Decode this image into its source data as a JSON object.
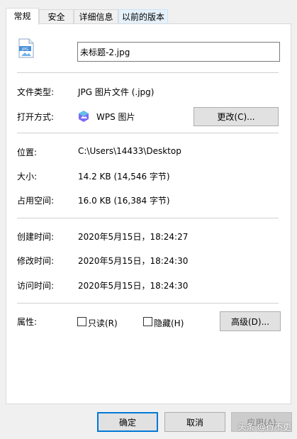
{
  "tabs": [
    {
      "label": "常规",
      "active": true
    },
    {
      "label": "安全"
    },
    {
      "label": "详细信息"
    },
    {
      "label": "以前的版本"
    }
  ],
  "file": {
    "icon": "jpg-file-icon",
    "icon_text": "JPG",
    "name": "未标题-2.jpg"
  },
  "props": {
    "type_label": "文件类型:",
    "type_value": "JPG 图片文件 (.jpg)",
    "open_label": "打开方式:",
    "open_app": "WPS 图片",
    "open_app_icon": "wps-image-icon",
    "change_button": "更改(C)...",
    "location_label": "位置:",
    "location_value": "C:\\Users\\14433\\Desktop",
    "size_label": "大小:",
    "size_value": "14.2 KB (14,546 字节)",
    "disk_label": "占用空间:",
    "disk_value": "16.0 KB (16,384 字节)",
    "created_label": "创建时间:",
    "created_value": "2020年5月15日，18:24:27",
    "modified_label": "修改时间:",
    "modified_value": "2020年5月15日，18:24:30",
    "accessed_label": "访问时间:",
    "accessed_value": "2020年5月15日，18:24:30",
    "attr_label": "属性:",
    "readonly_label": "只读(R)",
    "readonly_checked": false,
    "hidden_label": "隐藏(H)",
    "hidden_checked": false,
    "advanced_button": "高级(D)..."
  },
  "footer": {
    "ok": "确定",
    "cancel": "取消",
    "apply": "应用(A)",
    "apply_enabled": false
  },
  "watermark": "头条 @行不更",
  "colors": {
    "accent": "#0078d7",
    "wps_icon": "#7b6cf6"
  }
}
